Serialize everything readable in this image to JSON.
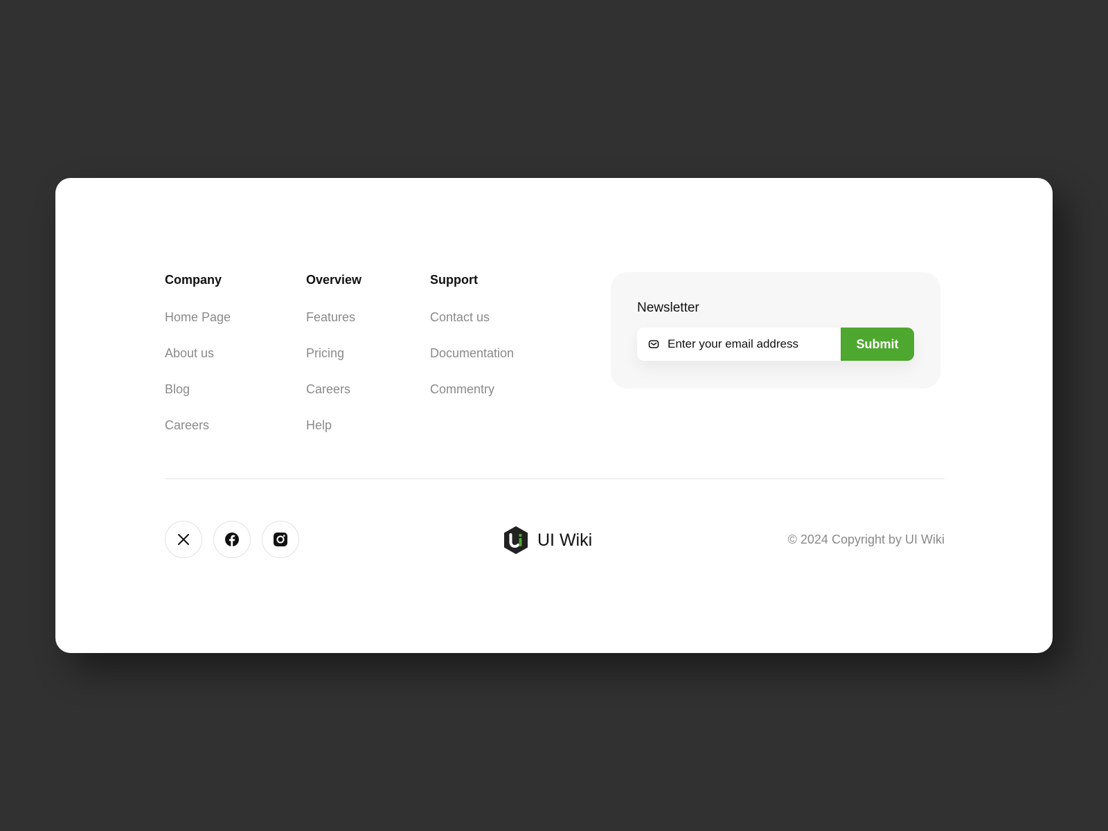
{
  "footer": {
    "columns": [
      {
        "title": "Company",
        "links": [
          "Home Page",
          "About us",
          "Blog",
          "Careers"
        ]
      },
      {
        "title": "Overview",
        "links": [
          "Features",
          "Pricing",
          "Careers",
          "Help"
        ]
      },
      {
        "title": "Support",
        "links": [
          "Contact us",
          "Documentation",
          "Commentry"
        ]
      }
    ],
    "newsletter": {
      "title": "Newsletter",
      "placeholder": "Enter your email address",
      "submit_label": "Submit",
      "icon": "mail-icon"
    },
    "socials": [
      {
        "name": "x",
        "icon": "x-icon"
      },
      {
        "name": "facebook",
        "icon": "facebook-icon"
      },
      {
        "name": "instagram",
        "icon": "instagram-icon"
      }
    ],
    "brand": {
      "name": "UI Wiki",
      "logo": "ui-wiki-logo"
    },
    "copyright": "© 2024 Copyright by UI Wiki",
    "colors": {
      "accent": "#4ea72e",
      "background": "#313131",
      "card": "#ffffff",
      "link": "#8a8a8a",
      "heading": "#111111"
    }
  }
}
